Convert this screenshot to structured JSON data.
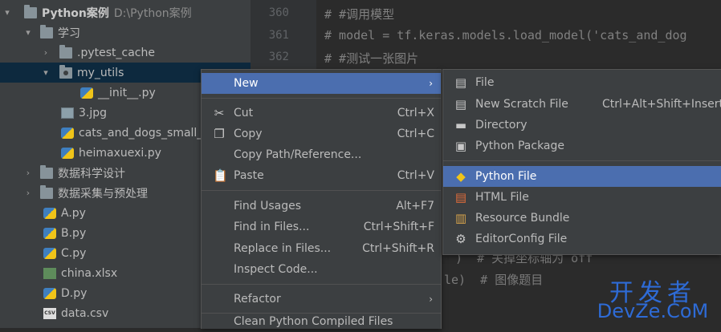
{
  "tree": {
    "root": {
      "name": "Python案例",
      "path": "D:\\Python案例"
    },
    "items": [
      {
        "label": "学习"
      },
      {
        "label": ".pytest_cache"
      },
      {
        "label": "my_utils"
      },
      {
        "label": "__init__.py"
      },
      {
        "label": "3.jpg"
      },
      {
        "label": "cats_and_dogs_small_"
      },
      {
        "label": "heimaxuexi.py"
      },
      {
        "label": "数据科学设计"
      },
      {
        "label": "数据采集与预处理"
      },
      {
        "label": "A.py"
      },
      {
        "label": "B.py"
      },
      {
        "label": "C.py"
      },
      {
        "label": "china.xlsx"
      },
      {
        "label": "D.py"
      },
      {
        "label": "data.csv"
      }
    ]
  },
  "editor": {
    "lines": [
      {
        "num": "360",
        "text": "# #调用模型"
      },
      {
        "num": "361",
        "text": "# model = tf.keras.models.load_model('cats_and_dog"
      },
      {
        "num": "362",
        "text": "# #测试一张图片"
      }
    ],
    "fragments": [
      {
        "text": ")  # 关掉坐标轴为 off"
      },
      {
        "text": "le)  # 图像题目"
      }
    ]
  },
  "context_menu": {
    "items": [
      {
        "label": "New",
        "shortcut": "",
        "submenu": "›"
      },
      {
        "label": "Cut",
        "shortcut": "Ctrl+X"
      },
      {
        "label": "Copy",
        "shortcut": "Ctrl+C"
      },
      {
        "label": "Copy Path/Reference...",
        "shortcut": ""
      },
      {
        "label": "Paste",
        "shortcut": "Ctrl+V"
      },
      {
        "label": "Find Usages",
        "shortcut": "Alt+F7"
      },
      {
        "label": "Find in Files...",
        "shortcut": "Ctrl+Shift+F"
      },
      {
        "label": "Replace in Files...",
        "shortcut": "Ctrl+Shift+R"
      },
      {
        "label": "Inspect Code...",
        "shortcut": ""
      },
      {
        "label": "Refactor",
        "shortcut": "",
        "submenu": "›"
      },
      {
        "label": "Clean Python Compiled Files",
        "shortcut": ""
      }
    ]
  },
  "new_submenu": {
    "items": [
      {
        "label": "File",
        "shortcut": ""
      },
      {
        "label": "New Scratch File",
        "shortcut": "Ctrl+Alt+Shift+Insert"
      },
      {
        "label": "Directory",
        "shortcut": ""
      },
      {
        "label": "Python Package",
        "shortcut": ""
      },
      {
        "label": "Python File",
        "shortcut": ""
      },
      {
        "label": "HTML File",
        "shortcut": ""
      },
      {
        "label": "Resource Bundle",
        "shortcut": ""
      },
      {
        "label": "EditorConfig File",
        "shortcut": ""
      }
    ]
  },
  "watermark": {
    "line1": "开发者",
    "line2": "DevZe.CoM"
  },
  "colors": {
    "highlight": "#4b6eaf",
    "selection": "#0d293e",
    "watermark": "#2e6bd6"
  }
}
